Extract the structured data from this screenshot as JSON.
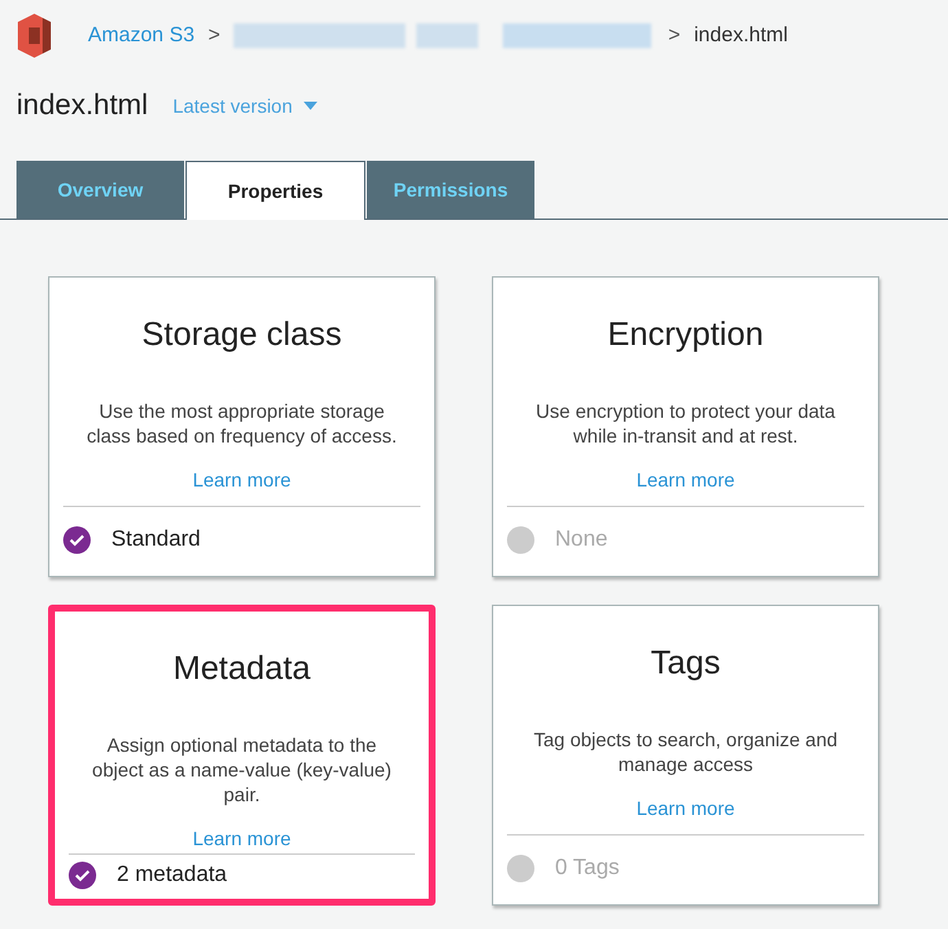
{
  "breadcrumb": {
    "root": "Amazon S3",
    "separators": [
      ">",
      ">"
    ],
    "current": "index.html"
  },
  "header": {
    "title": "index.html",
    "version": "Latest version"
  },
  "tabs": [
    {
      "label": "Overview",
      "selected": false
    },
    {
      "label": "Properties",
      "selected": true
    },
    {
      "label": "Permissions",
      "selected": false
    }
  ],
  "cards": [
    {
      "title": "Storage class",
      "description": "Use the most appropriate storage class based on frequency of access.",
      "link": "Learn more",
      "status": "Standard",
      "enabled": true,
      "highlighted": false
    },
    {
      "title": "Encryption",
      "description": "Use encryption to protect your data while in-transit and at rest.",
      "link": "Learn more",
      "status": "None",
      "enabled": false,
      "highlighted": false
    },
    {
      "title": "Metadata",
      "description": "Assign optional metadata to the object as a name-value (key-value) pair.",
      "link": "Learn more",
      "status": "2 metadata",
      "enabled": true,
      "highlighted": true
    },
    {
      "title": "Tags",
      "description": "Tag objects to search, organize and manage access",
      "link": "Learn more",
      "status": "0 Tags",
      "enabled": false,
      "highlighted": false
    }
  ]
}
